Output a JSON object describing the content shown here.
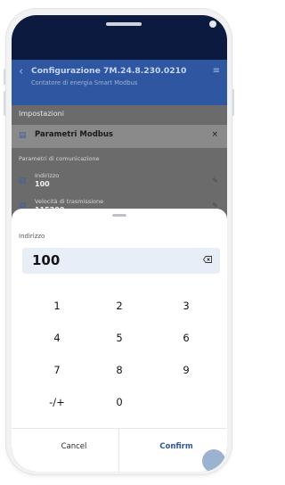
{
  "header": {
    "title": "Configurazione 7M.24.8.230.0210",
    "subtitle": "Contatore di energia Smart Modbus"
  },
  "settings": {
    "section_title": "Impostazioni",
    "card_title": "Parametri Modbus",
    "group_title": "Parametri di comunicazione",
    "rows": [
      {
        "label": "Indirizzo",
        "value": "100"
      },
      {
        "label": "Velocità di trasmissione",
        "value": "115200"
      }
    ]
  },
  "sheet": {
    "field_label": "Indirizzo",
    "value": "100",
    "keys": [
      "1",
      "2",
      "3",
      "4",
      "5",
      "6",
      "7",
      "8",
      "9",
      "-/+",
      "0"
    ],
    "cancel_label": "Cancel",
    "confirm_label": "Confirm"
  },
  "colors": {
    "header_bg": "#2f56a0",
    "status_bar": "#0b1a3e",
    "input_bg": "#e8eef7",
    "accent": "#2f56a0"
  },
  "icons": {
    "back": "back-arrow-icon",
    "menu": "menu-icon",
    "folder": "folder-icon",
    "close": "close-icon",
    "edit": "edit-icon",
    "backspace": "backspace-icon"
  }
}
